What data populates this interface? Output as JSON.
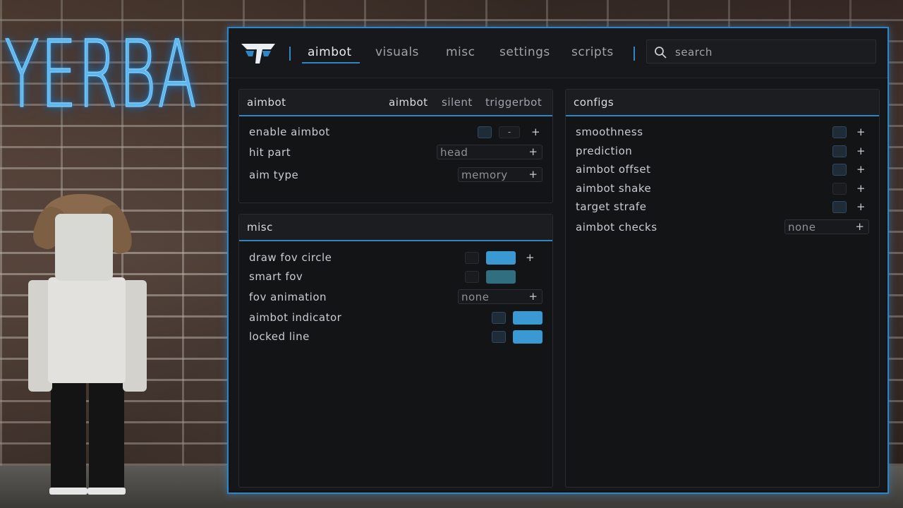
{
  "logo_text": "YERBA",
  "colors": {
    "accent": "#2f86c4",
    "swatch_blue": "#3a98d2",
    "swatch_teal": "#2f6f80"
  },
  "nav": {
    "tabs": [
      "aimbot",
      "visuals",
      "misc",
      "settings",
      "scripts"
    ],
    "active_tab": "aimbot"
  },
  "search": {
    "placeholder": "search"
  },
  "aimbot_section": {
    "title": "aimbot",
    "subtabs": [
      "aimbot",
      "silent",
      "triggerbot"
    ],
    "rows": {
      "enable": {
        "label": "enable aimbot",
        "minus": "-",
        "plus": "+"
      },
      "hit_part": {
        "label": "hit part",
        "value": "head"
      },
      "aim_type": {
        "label": "aim type",
        "value": "memory"
      }
    }
  },
  "misc_section": {
    "title": "misc",
    "rows": {
      "draw_fov": {
        "label": "draw fov circle"
      },
      "smart_fov": {
        "label": "smart fov"
      },
      "fov_animation": {
        "label": "fov animation",
        "value": "none"
      },
      "aimbot_indicator": {
        "label": "aimbot indicator"
      },
      "locked_line": {
        "label": "locked line"
      }
    }
  },
  "configs_section": {
    "title": "configs",
    "rows": {
      "smoothness": {
        "label": "smoothness"
      },
      "prediction": {
        "label": "prediction"
      },
      "aimbot_offset": {
        "label": "aimbot offset"
      },
      "aimbot_shake": {
        "label": "aimbot shake"
      },
      "target_strafe": {
        "label": "target strafe"
      },
      "aimbot_checks": {
        "label": "aimbot checks",
        "value": "none"
      }
    }
  },
  "plus_symbol": "+"
}
